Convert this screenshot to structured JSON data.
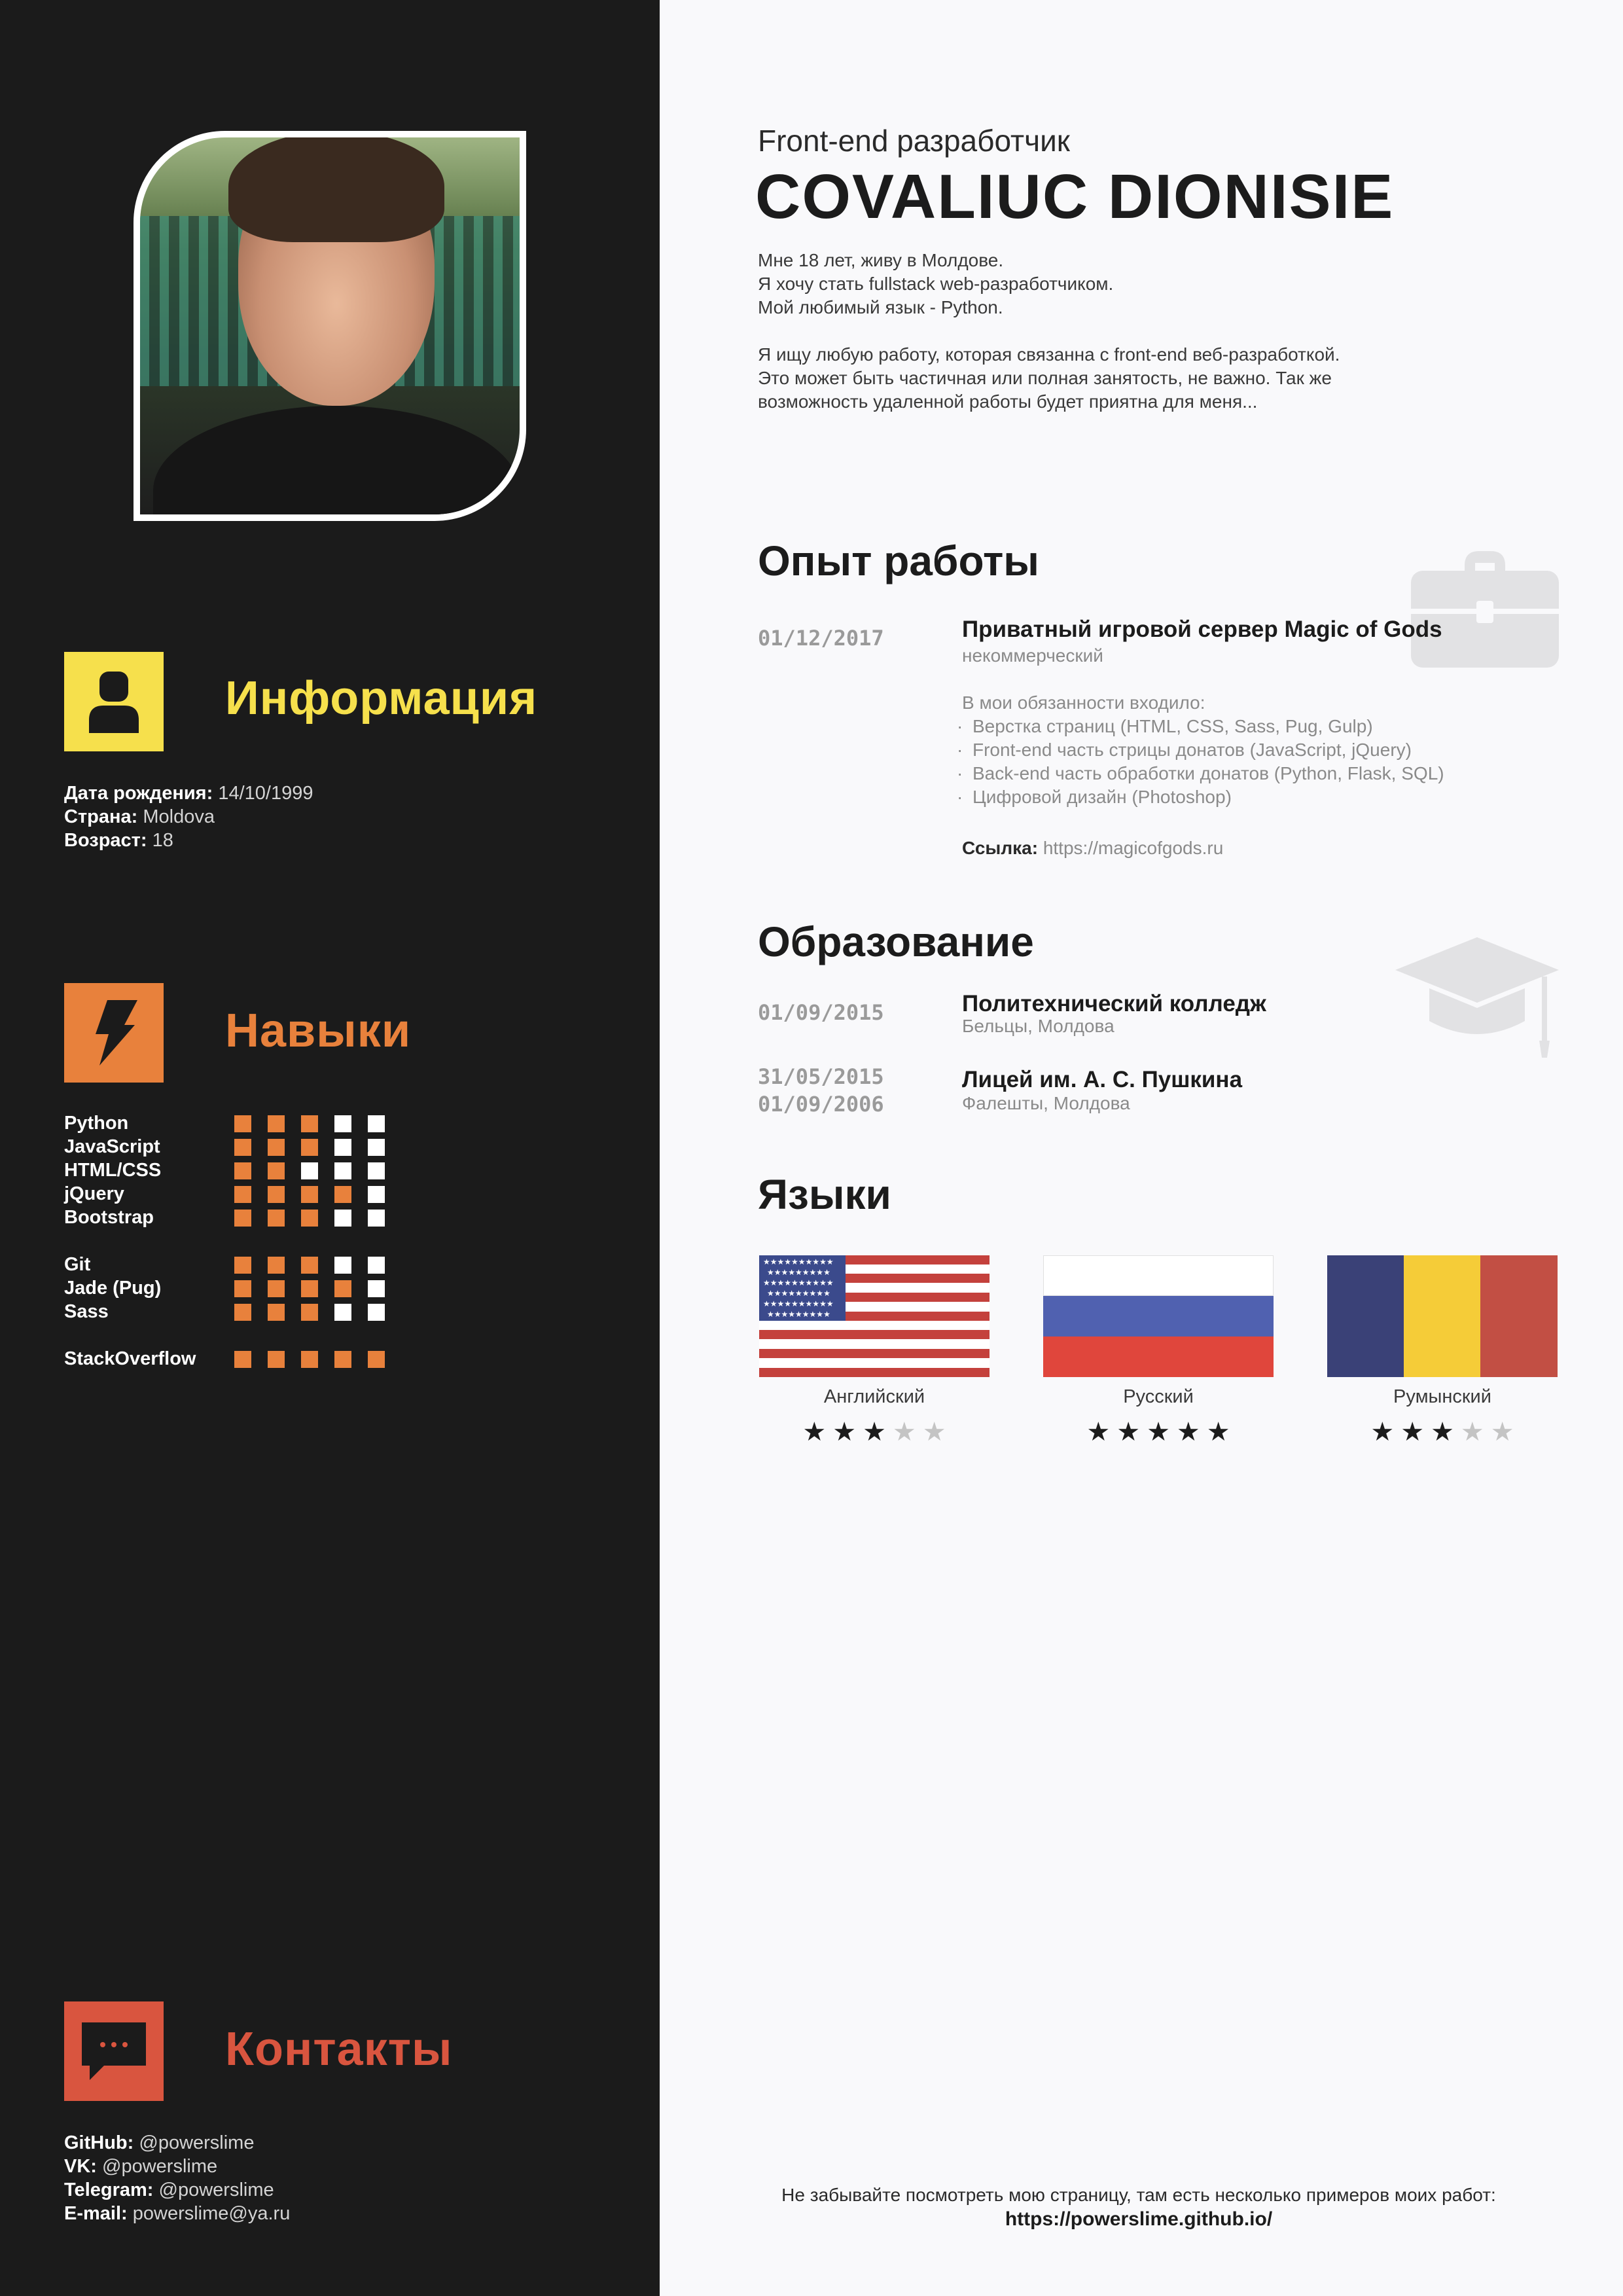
{
  "header": {
    "subtitle": "Front-end разработчик",
    "name": "COVALIUC DIONISIE",
    "about1": [
      "Мне 18 лет, живу в Молдове.",
      "Я хочу стать fullstack web-разработчиком.",
      "Мой любимый язык - Python."
    ],
    "about2": [
      "Я ищу любую работу, которая связанна с front-end веб-разработкой.",
      "Это может быть частичная или полная занятость, не важно. Так же",
      "возможность удаленной работы будет приятна для меня..."
    ]
  },
  "info": {
    "title": "Информация",
    "birth_label": "Дата рождения:",
    "birth_value": "14/10/1999",
    "country_label": "Страна:",
    "country_value": "Moldova",
    "age_label": "Возраст:",
    "age_value": "18"
  },
  "skills": {
    "title": "Навыки",
    "items": [
      {
        "name": "Python",
        "level": 3
      },
      {
        "name": "JavaScript",
        "level": 3
      },
      {
        "name": "HTML/CSS",
        "level": 2
      },
      {
        "name": "jQuery",
        "level": 4
      },
      {
        "name": "Bootstrap",
        "level": 3
      },
      {
        "name": "Git",
        "level": 3
      },
      {
        "name": "Jade (Pug)",
        "level": 4
      },
      {
        "name": "Sass",
        "level": 3
      },
      {
        "name": "StackOverflow",
        "level": 5
      }
    ],
    "max_level": 5
  },
  "contacts": {
    "title": "Контакты",
    "github_label": "GitHub:",
    "github_value": "@powerslime",
    "vk_label": "VK:",
    "vk_value": "@powerslime",
    "telegram_label": "Telegram:",
    "telegram_value": "@powerslime",
    "email_label": "E-mail:",
    "email_value": "powerslime@ya.ru"
  },
  "experience": {
    "title": "Опыт работы",
    "date": "01/12/2017",
    "company": "Приватный игровой сервер Magic of Gods",
    "type": "некоммерческий",
    "duties_intro": "В мои обязанности входило:",
    "duties": [
      "Верстка страниц (HTML, CSS, Sass, Pug, Gulp)",
      "Front-end часть стрицы донатов (JavaScript, jQuery)",
      "Back-end часть обработки донатов (Python, Flask, SQL)",
      "Цифровой дизайн (Photoshop)"
    ],
    "link_label": "Ссылка:",
    "link_value": "https://magicofgods.ru"
  },
  "education": {
    "title": "Образование",
    "items": [
      {
        "date1": "01/09/2015",
        "date2": "",
        "name": "Политехнический колледж",
        "place": "Бельцы, Молдова"
      },
      {
        "date1": "31/05/2015",
        "date2": "01/09/2006",
        "name": "Лицей им. А. С. Пушкина",
        "place": "Фалешты, Молдова"
      }
    ]
  },
  "languages": {
    "title": "Языки",
    "items": [
      {
        "name": "Английский",
        "rating": 3,
        "flag": "us"
      },
      {
        "name": "Русский",
        "rating": 5,
        "flag": "ru"
      },
      {
        "name": "Румынский",
        "rating": 3,
        "flag": "ro"
      }
    ],
    "max_rating": 5
  },
  "footer": {
    "note": "Не забывайте посмотреть мою страницу, там есть несколько примеров моих работ:",
    "link": "https://powerslime.github.io/"
  },
  "colors": {
    "sidebar_bg": "#1b1b1b",
    "info_accent": "#f6e04c",
    "skills_accent": "#e8813c",
    "contacts_accent": "#d9553f",
    "page_bg": "#f9f9fb"
  },
  "icons": [
    "user-icon",
    "lightning-icon",
    "chat-icon",
    "briefcase-icon",
    "graduation-cap-icon",
    "star-icon"
  ]
}
